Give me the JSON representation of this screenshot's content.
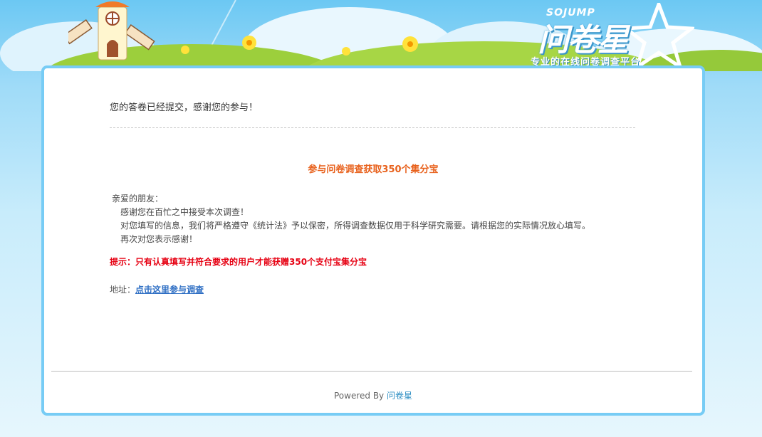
{
  "header": {
    "brand_en": "SOJUMP",
    "brand": "问卷星",
    "slogan": "专业的在线问卷调查平台"
  },
  "main": {
    "thanks_text": "您的答卷已经提交，感谢您的参与！",
    "promo_title": "参与问卷调查获取350个集分宝",
    "greeting": "亲爱的朋友：",
    "lines": [
      "感谢您在百忙之中接受本次调查！",
      "对您填写的信息，我们将严格遵守《统计法》予以保密，所得调查数据仅用于科学研究需要。请根据您的实际情况放心填写。",
      "再次对您表示感谢！"
    ],
    "tip": "提示：只有认真填写并符合要求的用户才能获赠350个支付宝集分宝",
    "address_label": "地址：",
    "address_link": "点击这里参与调查"
  },
  "footer": {
    "powered_by": "Powered By",
    "powered_link": "问卷星"
  },
  "colors": {
    "accent": "#e8611c",
    "tip": "#e60012",
    "border": "#77ccf5",
    "link": "#2f6fc4"
  }
}
